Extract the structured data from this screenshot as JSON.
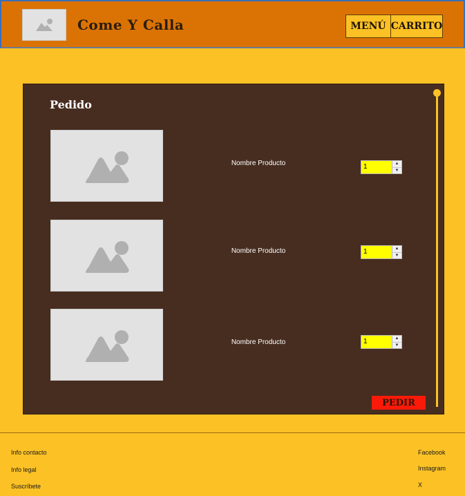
{
  "header": {
    "logo_icon": "image-placeholder-icon",
    "brand": "Come Y Calla",
    "nav": [
      {
        "label": "MENÚ"
      },
      {
        "label": "CARRITO"
      }
    ]
  },
  "order": {
    "title": "Pedido",
    "items": [
      {
        "image_icon": "image-placeholder-icon",
        "name": "Nombre Producto",
        "quantity": "1"
      },
      {
        "image_icon": "image-placeholder-icon",
        "name": "Nombre Producto",
        "quantity": "1"
      },
      {
        "image_icon": "image-placeholder-icon",
        "name": "Nombre Producto",
        "quantity": "1"
      }
    ],
    "order_button": "PEDIR"
  },
  "footer": {
    "left_links": [
      "Info contacto",
      "Info legal",
      "Suscríbete"
    ],
    "right_links": [
      "Facebook",
      "Instagram",
      "X"
    ]
  },
  "colors": {
    "header_bg": "#db7304",
    "page_bg": "#fcc125",
    "panel_bg": "#472d20",
    "quantity_bg": "#ffff00",
    "order_button_bg": "#fb1a09"
  }
}
